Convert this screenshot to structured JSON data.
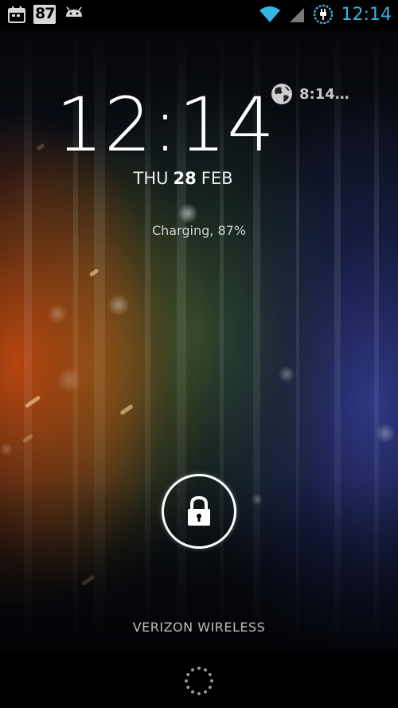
{
  "status_bar": {
    "time": "12:14",
    "notification_badge": "87",
    "left_icons": [
      "calendar-icon",
      "badge-87",
      "android-icon"
    ],
    "right_icons": [
      "wifi-icon",
      "cell-signal-icon",
      "battery-charging-icon"
    ],
    "accent_color": "#33b5e5"
  },
  "lockscreen": {
    "clock": "12:14",
    "date": {
      "weekday": "THU",
      "day": "28",
      "month": "FEB"
    },
    "battery_status": "Charging, 87%",
    "world_clock": {
      "time": "8:14…",
      "icon": "globe-icon"
    },
    "unlock_icon": "lock-icon",
    "carrier": "VERIZON WIRELESS"
  },
  "nav_bar": {
    "icon": "loading-spinner-icon"
  }
}
